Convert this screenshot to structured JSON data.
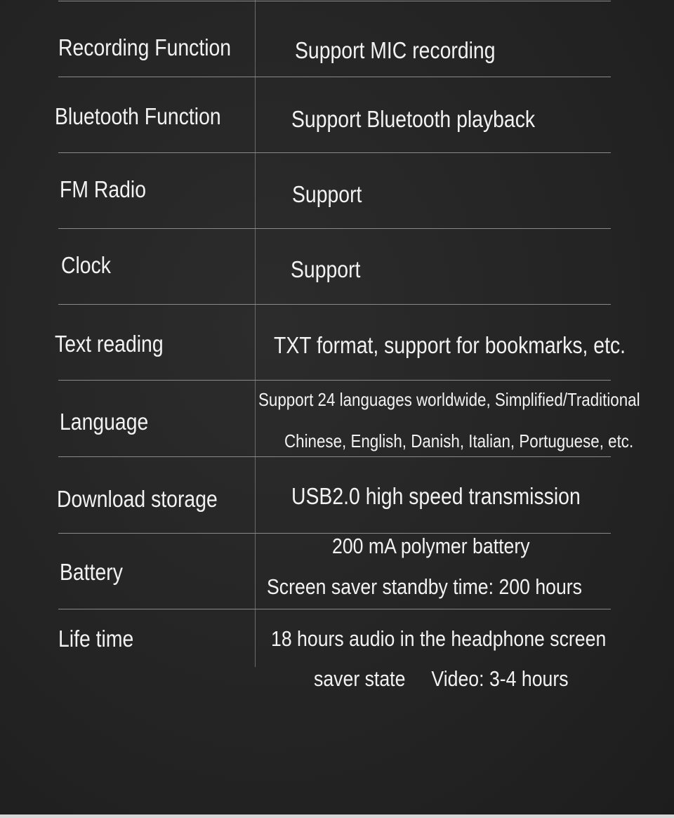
{
  "specs": [
    {
      "label": "Recording Function",
      "value": [
        "Support MIC recording"
      ]
    },
    {
      "label": "Bluetooth Function",
      "value": [
        "Support Bluetooth playback"
      ]
    },
    {
      "label": "FM Radio",
      "value": [
        "Support"
      ]
    },
    {
      "label": "Clock",
      "value": [
        "Support"
      ]
    },
    {
      "label": "Text reading",
      "value": [
        "TXT format, support for bookmarks, etc."
      ]
    },
    {
      "label": "Language",
      "value": [
        "Support 24 languages worldwide, Simplified/Traditional",
        "Chinese, English, Danish, Italian, Portuguese, etc."
      ]
    },
    {
      "label": "Download storage",
      "value": [
        "USB2.0 high speed transmission"
      ]
    },
    {
      "label": "Battery",
      "value": [
        "200 mA polymer battery",
        "Screen saver standby time: 200 hours"
      ]
    },
    {
      "label": "Life time",
      "value": [
        "18 hours audio in the headphone screen",
        "saver state     Video: 3-4 hours"
      ]
    }
  ]
}
